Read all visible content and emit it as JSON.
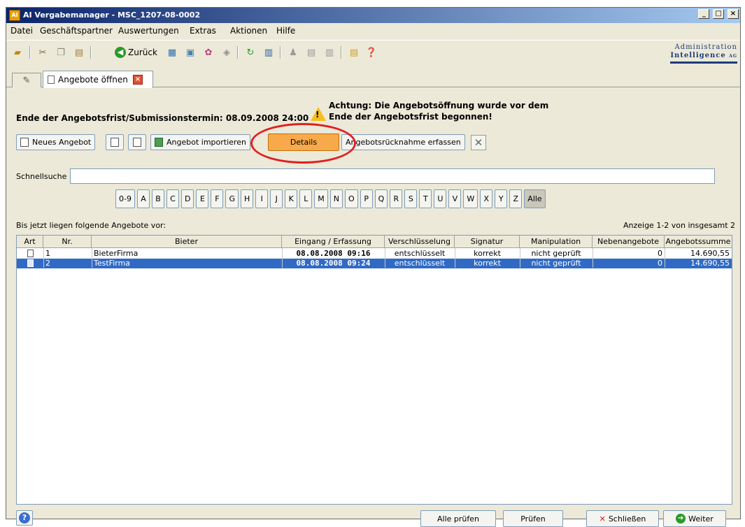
{
  "window": {
    "title": "AI Vergabemanager - MSC_1207-08-0002",
    "app_icon": "AI",
    "minimize": "_",
    "maximize": "□",
    "close": "×"
  },
  "menu": [
    "Datei",
    "Geschäftspartner",
    "Auswertungen",
    "Extras",
    "Aktionen",
    "Hilfe"
  ],
  "toolbar": {
    "back_label": "Zurück",
    "brand_line1": "Administration",
    "brand_line2": "Intelligence",
    "brand_suffix": "AG"
  },
  "tabs": {
    "active_label": "Angebote öffnen",
    "close_icon": "×"
  },
  "panel": {
    "deadline": "Ende der Angebotsfrist/Submissionstermin: 08.09.2008 24:00",
    "warning_mark": "!",
    "warning_line1": "Achtung: Die Angebotsöffnung wurde vor dem",
    "warning_line2": "Ende der Angebotsfrist begonnen!",
    "buttons": {
      "new_offer": "Neues Angebot",
      "import": "Angebot importieren",
      "details": "Details",
      "withdrawal": "Angebotsrücknahme erfassen",
      "delete_icon": "✕"
    },
    "search_label": "Schnellsuche",
    "search_value": "",
    "letters": [
      "0-9",
      "A",
      "B",
      "C",
      "D",
      "E",
      "F",
      "G",
      "H",
      "I",
      "J",
      "K",
      "L",
      "M",
      "N",
      "O",
      "P",
      "Q",
      "R",
      "S",
      "T",
      "U",
      "V",
      "W",
      "X",
      "Y",
      "Z",
      "Alle"
    ],
    "selected_letter": "Alle",
    "list_label": "Bis jetzt liegen folgende Angebote vor:",
    "count_label": "Anzeige 1-2 von insgesamt 2"
  },
  "table": {
    "columns": [
      "Art",
      "Nr.",
      "Bieter",
      "Eingang / Erfassung",
      "Verschlüsselung",
      "Signatur",
      "Manipulation",
      "Nebenangebote",
      "Angebotssumme"
    ],
    "rows": [
      {
        "nr": "1",
        "bieter": "BieterFirma",
        "eingang": "08.08.2008 09:16",
        "verschluesselung": "entschlüsselt",
        "signatur": "korrekt",
        "manipulation": "nicht geprüft",
        "nebenangebote": "0",
        "summe": "14.690,55",
        "selected": false
      },
      {
        "nr": "2",
        "bieter": "TestFirma",
        "eingang": "08.08.2008 09:24",
        "verschluesselung": "entschlüsselt",
        "signatur": "korrekt",
        "manipulation": "nicht geprüft",
        "nebenangebote": "0",
        "summe": "14.690,55",
        "selected": true
      }
    ]
  },
  "footer": {
    "help": "?",
    "check_all": "Alle prüfen",
    "check": "Prüfen",
    "close": "Schließen",
    "close_icon": "✕",
    "next": "Weiter",
    "next_icon": "➜"
  }
}
